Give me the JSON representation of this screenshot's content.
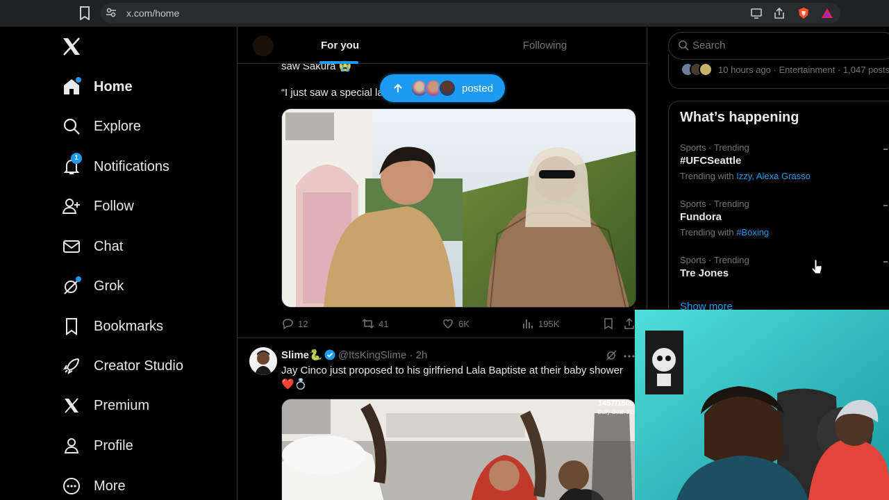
{
  "browser": {
    "url": "x.com/home"
  },
  "nav": {
    "items": [
      {
        "label": "Home",
        "icon": "home-icon",
        "active": true
      },
      {
        "label": "Explore",
        "icon": "search-icon"
      },
      {
        "label": "Notifications",
        "icon": "bell-icon",
        "badge": "1"
      },
      {
        "label": "Follow",
        "icon": "person-add-icon"
      },
      {
        "label": "Chat",
        "icon": "mail-icon"
      },
      {
        "label": "Grok",
        "icon": "grok-icon"
      },
      {
        "label": "Bookmarks",
        "icon": "bookmark-icon"
      },
      {
        "label": "Creator Studio",
        "icon": "rocket-icon"
      },
      {
        "label": "Premium",
        "icon": "x-logo-icon"
      },
      {
        "label": "Profile",
        "icon": "person-icon"
      },
      {
        "label": "More",
        "icon": "more-circle-icon"
      }
    ]
  },
  "tabs": {
    "for_you": "For you",
    "following": "Following"
  },
  "posted_pill": {
    "label": "posted"
  },
  "tweet1": {
    "text_fragment": "saw Sakura 😭",
    "quote_fragment": "“I just saw a special la",
    "stats": {
      "replies": "12",
      "reposts": "41",
      "likes": "6K",
      "views": "195K"
    }
  },
  "tweet2": {
    "name": "Slime🐍",
    "handle": "@ItsKingSlime · 2h",
    "text_line1": "Jay Cinco just proposed to his girlfriend Lala Baptiste at their baby shower",
    "text_line2": "❤️💍",
    "overlay_text": "1457/1500",
    "overlay_sub": "Daily Goal: 2/3"
  },
  "right": {
    "search_placeholder": "Search",
    "news_meta": "10 hours ago · Entertainment · 1,047 posts",
    "trends_title": "What’s happening",
    "trends": [
      {
        "category": "Sports · Trending",
        "name": "#UFCSeattle",
        "with_label": "Trending with",
        "with_links": "Izzy, Alexa Grasso"
      },
      {
        "category": "Sports · Trending",
        "name": "Fundora",
        "with_label": "Trending with",
        "with_links": "#Boxing"
      },
      {
        "category": "Sports · Trending",
        "name": "Tre Jones"
      }
    ],
    "show_more": "Show more"
  },
  "colors": {
    "accent": "#1d9bf0",
    "background": "#000000",
    "border": "#2f3336",
    "muted": "#71767b"
  }
}
